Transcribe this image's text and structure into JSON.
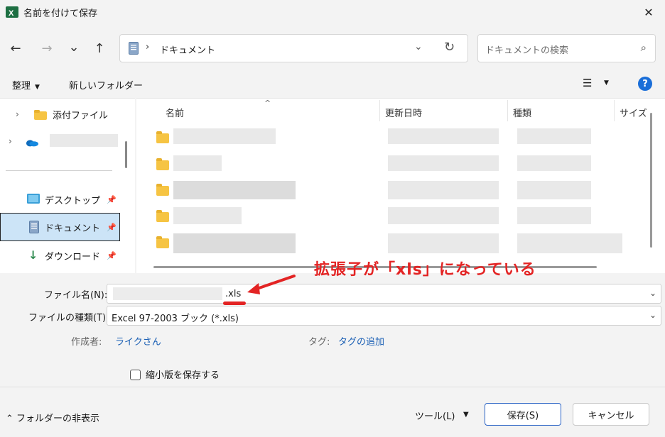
{
  "window": {
    "title": "名前を付けて保存",
    "app_icon": "excel-icon",
    "close": "✕"
  },
  "nav": {
    "back": "←",
    "forward": "→",
    "recent": "⌄",
    "up": "↑",
    "breadcrumb_sep": "›",
    "location": "ドキュメント",
    "search_placeholder": "ドキュメントの検索"
  },
  "toolbar": {
    "organize": "整理",
    "new_folder": "新しいフォルダー",
    "help": "?"
  },
  "sidebar": {
    "items": [
      {
        "label": "添付ファイル",
        "icon": "folder-icon"
      },
      {
        "label": "",
        "icon": "onedrive-icon"
      },
      {
        "label": "デスクトップ",
        "icon": "desktop-icon"
      },
      {
        "label": "ドキュメント",
        "icon": "documents-icon"
      },
      {
        "label": "ダウンロード",
        "icon": "download-icon"
      }
    ]
  },
  "filelist": {
    "columns": [
      "名前",
      "更新日時",
      "種類",
      "サイズ"
    ],
    "rows": 5
  },
  "form": {
    "filename_label": "ファイル名(N):",
    "filename_value": ".xls",
    "filetype_label": "ファイルの種類(T):",
    "filetype_value": "Excel 97-2003 ブック (*.xls)",
    "author_label": "作成者:",
    "author_value": "ライクさん",
    "tags_label": "タグ:",
    "tags_value": "タグの追加",
    "thumbnail_label": "縮小版を保存する"
  },
  "annotation": {
    "text": "拡張子が「xls」になっている",
    "color": "#e32424"
  },
  "footer": {
    "hide_folders": "フォルダーの非表示",
    "tools": "ツール(L)",
    "save": "保存(S)",
    "cancel": "キャンセル"
  },
  "colors": {
    "accent": "#1a6ed8",
    "selection": "#cce4f7",
    "folder": "#f6c443",
    "annotation": "#e32424"
  }
}
